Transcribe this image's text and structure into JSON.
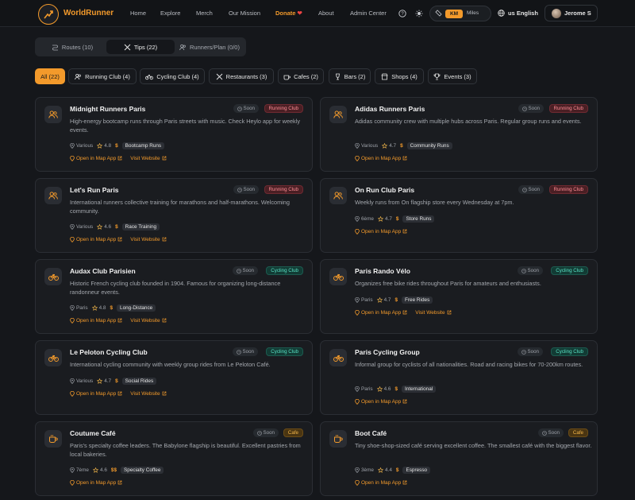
{
  "header": {
    "brand": "WorldRunner",
    "nav": [
      "Home",
      "Explore",
      "Merch",
      "Our Mission",
      "Donate",
      "About",
      "Admin Center"
    ],
    "units": {
      "km": "KM",
      "miles": "Miles",
      "selected": "KM"
    },
    "language": "us English",
    "user": "Jerome S",
    "colors": {
      "accent": "#f39a2b",
      "background": "#15171b"
    }
  },
  "tabs": [
    {
      "label": "Routes (10)",
      "icon": "route-icon"
    },
    {
      "label": "Tips (22)",
      "icon": "tools-icon",
      "active": true
    },
    {
      "label": "Runners/Plan (0/0)",
      "icon": "users-icon"
    }
  ],
  "filters": [
    {
      "label": "All (22)",
      "active": true
    },
    {
      "label": "Running Club (4)",
      "icon": "users-icon"
    },
    {
      "label": "Cycling Club (4)",
      "icon": "bike-icon"
    },
    {
      "label": "Restaurants (3)",
      "icon": "utensils-icon"
    },
    {
      "label": "Cafes (2)",
      "icon": "coffee-icon"
    },
    {
      "label": "Bars (2)",
      "icon": "wine-icon"
    },
    {
      "label": "Shops (4)",
      "icon": "shop-icon"
    },
    {
      "label": "Events (3)",
      "icon": "trophy-icon"
    }
  ],
  "labels": {
    "soon": "Soon",
    "open_map": "Open in Map App",
    "visit": "Visit Website"
  },
  "cards": [
    {
      "title": "Midnight Runners Paris",
      "category": "Running Club",
      "desc": "High-energy bootcamp runs through Paris streets with music. Check Heylo app for weekly events.",
      "location": "Various",
      "rating": "4.8",
      "price": "$",
      "tag": "Bootcamp Runs",
      "website": true
    },
    {
      "title": "Adidas Runners Paris",
      "category": "Running Club",
      "desc": "Adidas community crew with multiple hubs across Paris. Regular group runs and events.",
      "location": "Various",
      "rating": "4.7",
      "price": "$",
      "tag": "Community Runs",
      "website": false
    },
    {
      "title": "Let's Run Paris",
      "category": "Running Club",
      "desc": "International runners collective training for marathons and half-marathons. Welcoming community.",
      "location": "Various",
      "rating": "4.6",
      "price": "$",
      "tag": "Race Training",
      "website": true
    },
    {
      "title": "On Run Club Paris",
      "category": "Running Club",
      "desc": "Weekly runs from On flagship store every Wednesday at 7pm.",
      "location": "6ème",
      "rating": "4.7",
      "price": "$",
      "tag": "Store Runs",
      "website": false
    },
    {
      "title": "Audax Club Parisien",
      "category": "Cycling Club",
      "desc": "Historic French cycling club founded in 1904. Famous for organizing long-distance randonneur events.",
      "location": "Paris",
      "rating": "4.8",
      "price": "$",
      "tag": "Long-Distance",
      "website": true
    },
    {
      "title": "Paris Rando Vélo",
      "category": "Cycling Club",
      "desc": "Organizes free bike rides throughout Paris for amateurs and enthusiasts.",
      "location": "Paris",
      "rating": "4.7",
      "price": "$",
      "tag": "Free Rides",
      "website": true
    },
    {
      "title": "Le Peloton Cycling Club",
      "category": "Cycling Club",
      "desc": "International cycling community with weekly group rides from Le Peloton Café.",
      "location": "Various",
      "rating": "4.7",
      "price": "$",
      "tag": "Social Rides",
      "website": true
    },
    {
      "title": "Paris Cycling Group",
      "category": "Cycling Club",
      "desc": "Informal group for cyclists of all nationalities. Road and racing bikes for 70-200km routes.",
      "location": "Paris",
      "rating": "4.6",
      "price": "$",
      "tag": "International",
      "website": false
    },
    {
      "title": "Coutume Café",
      "category": "Cafe",
      "desc": "Paris's specialty coffee leaders. The Babylone flagship is beautiful. Excellent pastries from local bakeries.",
      "location": "7ème",
      "rating": "4.6",
      "price": "$$",
      "tag": "Specialty Coffee",
      "website": false
    },
    {
      "title": "Boot Café",
      "category": "Cafe",
      "desc": "Tiny shoe-shop-sized café serving excellent coffee. The smallest café with the biggest flavor.",
      "location": "3ème",
      "rating": "4.4",
      "price": "$",
      "tag": "Espresso",
      "website": false
    }
  ]
}
